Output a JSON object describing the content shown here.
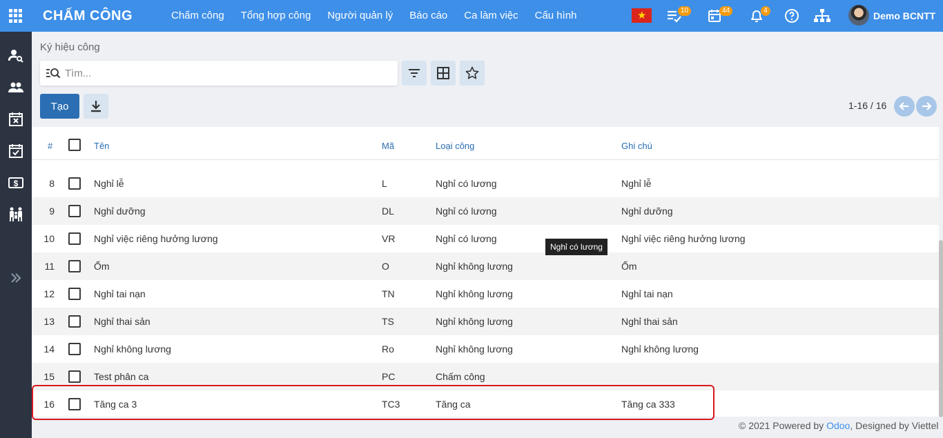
{
  "app": {
    "title": "CHẤM CÔNG"
  },
  "nav": [
    "Chấm công",
    "Tổng hợp công",
    "Người quản lý",
    "Báo cáo",
    "Ca làm việc",
    "Cấu hình"
  ],
  "topbar": {
    "messages_badge": "10",
    "calendar_badge": "44",
    "notifications_badge": "4",
    "user_name": "Demo BCNTT"
  },
  "breadcrumb": "Ký hiệu công",
  "search": {
    "placeholder": "Tìm..."
  },
  "buttons": {
    "create": "Tạo"
  },
  "pager": {
    "text": "1-16 / 16"
  },
  "table": {
    "headers": {
      "index": "#",
      "name": "Tên",
      "code": "Mã",
      "type": "Loại công",
      "note": "Ghi chú"
    },
    "rows": [
      {
        "num": "8",
        "name": "Nghỉ lễ",
        "code": "L",
        "type": "Nghỉ có lương",
        "note": "Nghỉ lễ"
      },
      {
        "num": "9",
        "name": "Nghỉ dưỡng",
        "code": "DL",
        "type": "Nghỉ có lương",
        "note": "Nghỉ dưỡng"
      },
      {
        "num": "10",
        "name": "Nghỉ việc riêng hưởng lương",
        "code": "VR",
        "type": "Nghỉ có lương",
        "note": "Nghỉ việc riêng hưởng lương"
      },
      {
        "num": "11",
        "name": "Ốm",
        "code": "O",
        "type": "Nghỉ không lương",
        "note": "Ốm"
      },
      {
        "num": "12",
        "name": "Nghỉ tai nạn",
        "code": "TN",
        "type": "Nghỉ không lương",
        "note": "Nghỉ tai nạn"
      },
      {
        "num": "13",
        "name": "Nghỉ thai sản",
        "code": "TS",
        "type": "Nghỉ không lương",
        "note": "Nghỉ thai sản"
      },
      {
        "num": "14",
        "name": "Nghỉ không lương",
        "code": "Ro",
        "type": "Nghỉ không lương",
        "note": "Nghỉ không lương"
      },
      {
        "num": "15",
        "name": "Test phân ca",
        "code": "PC",
        "type": "Chấm công",
        "note": ""
      },
      {
        "num": "16",
        "name": "Tăng ca 3",
        "code": "TC3",
        "type": "Tăng ca",
        "note": "Tăng ca 333"
      }
    ]
  },
  "tooltip": "Nghỉ có lương",
  "footer": {
    "prefix": "© 2021 Powered by ",
    "brand": "Odoo",
    "suffix": ", Designed by Viettel"
  },
  "colors": {
    "topbar": "#3d8fe8",
    "sidebar": "#2c3442",
    "primary": "#2b6eb3",
    "highlight": "#d71920",
    "badge": "#f39c12"
  }
}
